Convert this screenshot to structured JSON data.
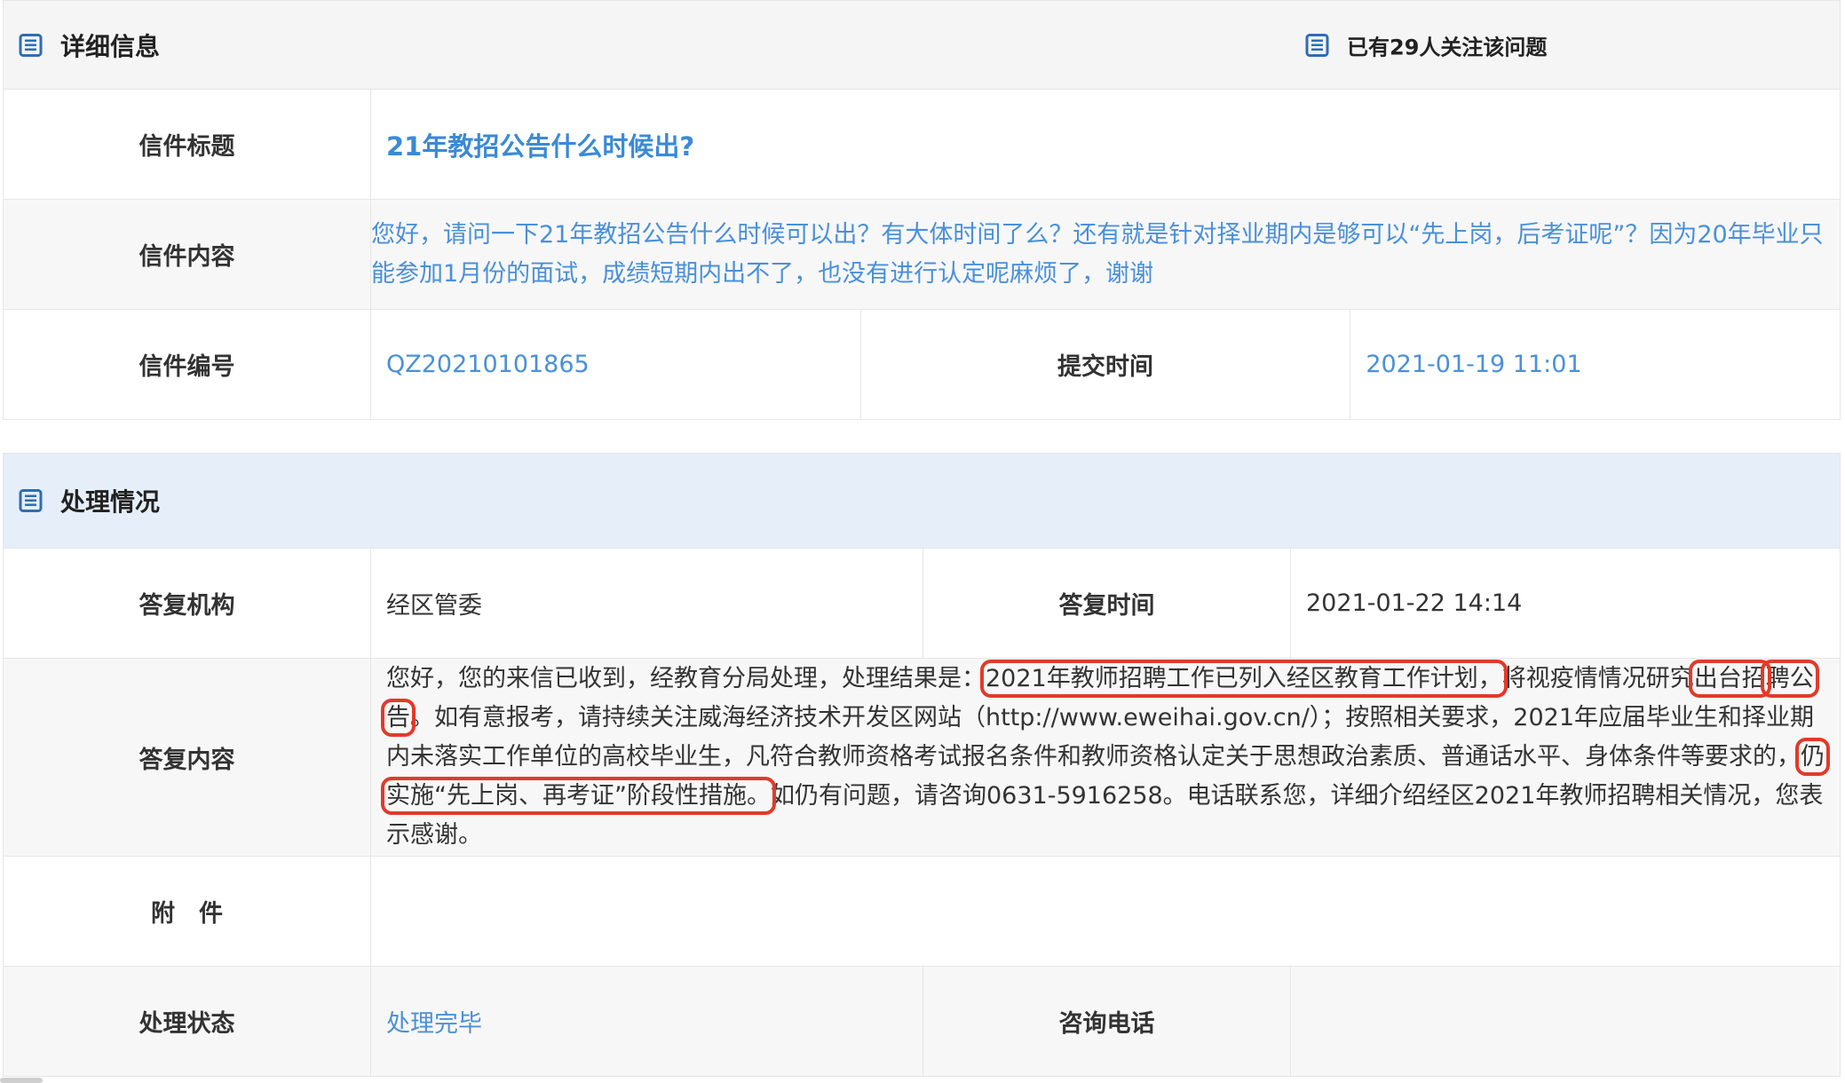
{
  "detail": {
    "header_title": "详细信息",
    "follow_text": "已有29人关注该问题",
    "letter_title_label": "信件标题",
    "letter_title": "21年教招公告什么时候出?",
    "letter_content_label": "信件内容",
    "letter_content": "您好，请问一下21年教招公告什么时候可以出？有大体时间了么？还有就是针对择业期内是够可以“先上岗，后考证呢”？因为20年毕业只能参加1月份的面试，成绩短期内出不了，也没有进行认定呢麻烦了，谢谢",
    "letter_no_label": "信件编号",
    "letter_no": "QZ20210101865",
    "submit_time_label": "提交时间",
    "submit_time": "2021-01-19 11:01"
  },
  "handle": {
    "header_title": "处理情况",
    "org_label": "答复机构",
    "org": "经区管委",
    "reply_time_label": "答复时间",
    "reply_time": "2021-01-22 14:14",
    "reply_content_label": "答复内容",
    "reply_parts": {
      "p1": "您好，您的来信已收到，经教育分局处理，处理结果是：",
      "h1": "2021年教师招聘工作已列入经区教育工作计划，",
      "p2": "将视疫情情况研究",
      "h2a": "出台招",
      "h2b": "聘公告",
      "p3": "。如有意报考，请持续关注威海经济技术开发区网站（http://www.eweihai.gov.cn/）；按照相关要求，2021年应届毕业生和择业期内未落实工作单位的高校毕业生，凡符合教师资格考试报名条件和教师资格认定关于思想政治素质、普通话水平、身体条件等要求的，",
      "h3": "仍实施“先上岗、再考证”阶段性措施。",
      "p4": "如仍有问题，请咨询0631-5916258。电话联系您，详细介绍经区2021年教师招聘相关情况，您表示感谢。"
    },
    "attachment_label": "附　件",
    "attachment": "",
    "status_label": "处理状态",
    "status": "处理完毕",
    "phone_label": "咨询电话",
    "phone": ""
  },
  "colors": {
    "link_blue": "#4a90d9",
    "highlight_red": "#e03b2a",
    "header_blue_bg": "#e6eff9"
  },
  "icons": {
    "section_icon": "list-document-icon"
  }
}
